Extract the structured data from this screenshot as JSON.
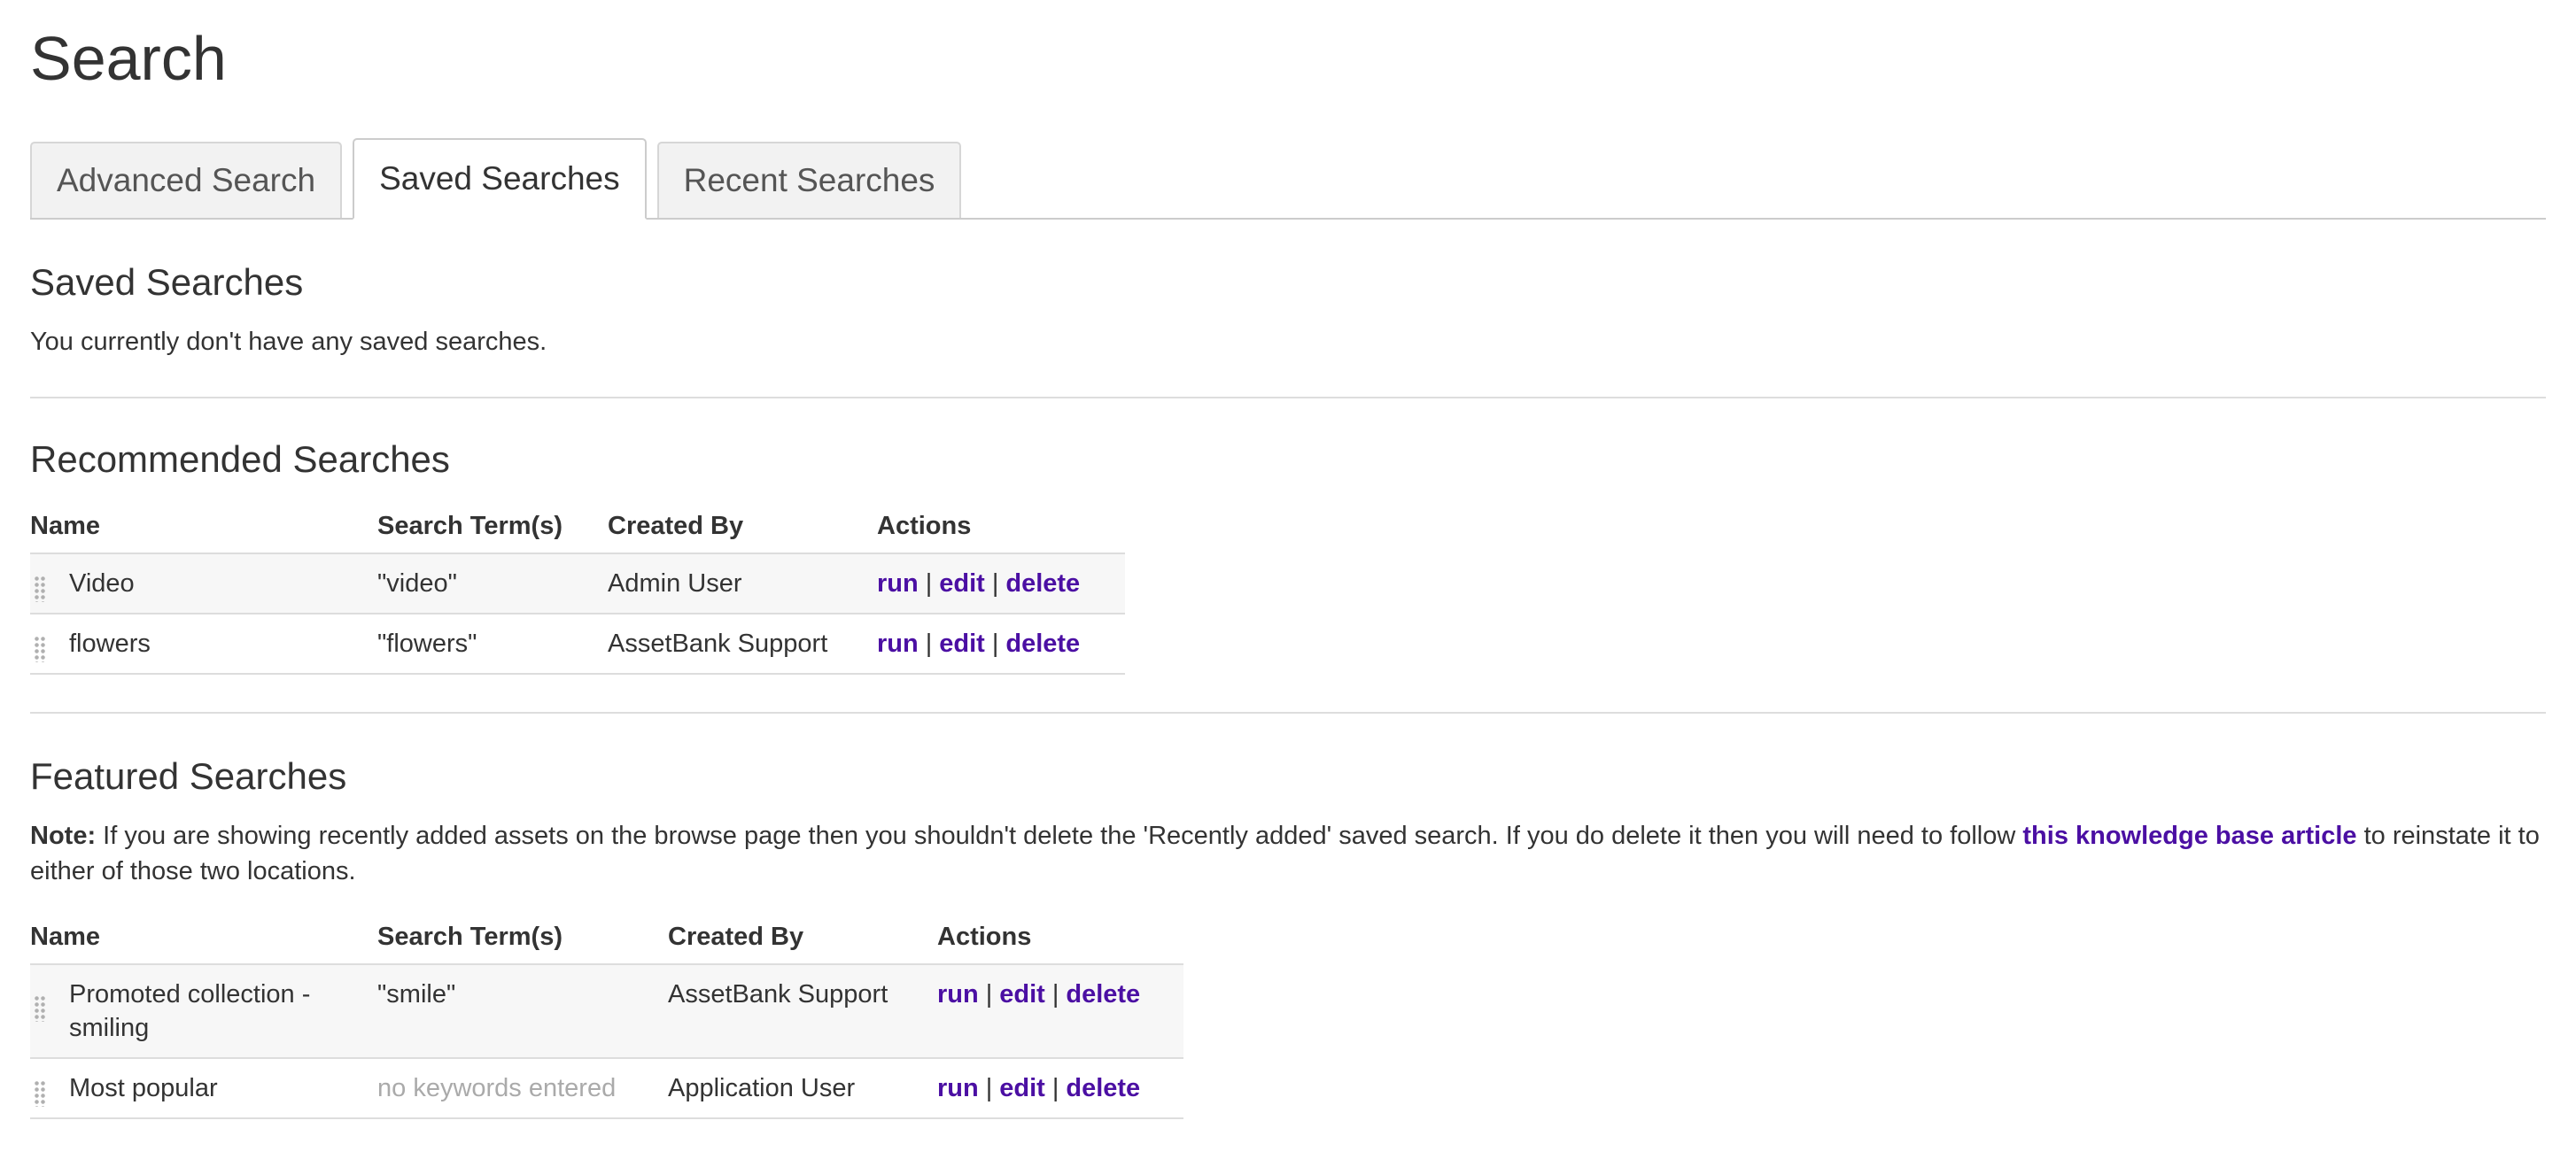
{
  "page": {
    "title": "Search"
  },
  "tabs": [
    {
      "label": "Advanced Search",
      "active": false
    },
    {
      "label": "Saved Searches",
      "active": true
    },
    {
      "label": "Recent Searches",
      "active": false
    }
  ],
  "saved": {
    "heading": "Saved Searches",
    "empty_text": "You currently don't have any saved searches."
  },
  "recommended": {
    "heading": "Recommended Searches",
    "columns": [
      "Name",
      "Search Term(s)",
      "Created By",
      "Actions"
    ],
    "rows": [
      {
        "name": "Video",
        "terms": "\"video\"",
        "created_by": "Admin User"
      },
      {
        "name": "flowers",
        "terms": "\"flowers\"",
        "created_by": "AssetBank Support"
      }
    ]
  },
  "featured": {
    "heading": "Featured Searches",
    "note_label": "Note:",
    "note_text_before": " If you are showing recently added assets on the browse page then you shouldn't delete the 'Recently added' saved search. If you do delete it then you will need to follow ",
    "note_link": "this knowledge base article",
    "note_text_after": " to reinstate it to either of those two locations.",
    "columns": [
      "Name",
      "Search Term(s)",
      "Created By",
      "Actions"
    ],
    "rows": [
      {
        "name": "Promoted collection - smiling",
        "terms": "\"smile\"",
        "created_by": "AssetBank Support"
      },
      {
        "name": "Most popular",
        "terms": "no keywords entered",
        "created_by": "Application User"
      }
    ]
  },
  "actions": {
    "run": "run",
    "edit": "edit",
    "delete": "delete",
    "separator": "|"
  },
  "colors": {
    "link": "#4b0fa3",
    "text": "#333333",
    "muted": "#aaaaaa",
    "row_alt": "#f7f7f7",
    "border": "#dddddd"
  }
}
